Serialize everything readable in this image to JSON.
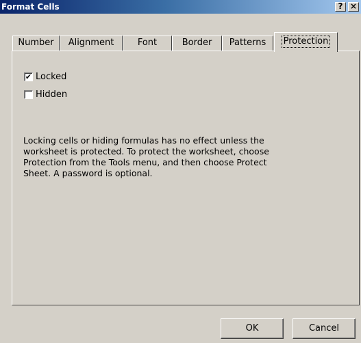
{
  "window": {
    "title": "Format Cells",
    "help_label": "?",
    "close_label": "×"
  },
  "tabs": [
    {
      "label": "Number"
    },
    {
      "label": "Alignment"
    },
    {
      "label": "Font"
    },
    {
      "label": "Border"
    },
    {
      "label": "Patterns"
    },
    {
      "label": "Protection",
      "active": true
    }
  ],
  "protection": {
    "locked": {
      "label": "Locked",
      "checked": true
    },
    "hidden": {
      "label": "Hidden",
      "checked": false
    },
    "info_text": "Locking cells or hiding formulas has no effect unless the\nworksheet is protected. To protect the worksheet, choose\nProtection from the Tools menu, and then choose Protect\nSheet. A password is optional."
  },
  "buttons": {
    "ok_label": "OK",
    "cancel_label": "Cancel"
  },
  "colors": {
    "face": "#d4d0c8",
    "title_bar_start": "#0a246a",
    "title_bar_end": "#a6caf0",
    "title_text": "#ffffff"
  }
}
